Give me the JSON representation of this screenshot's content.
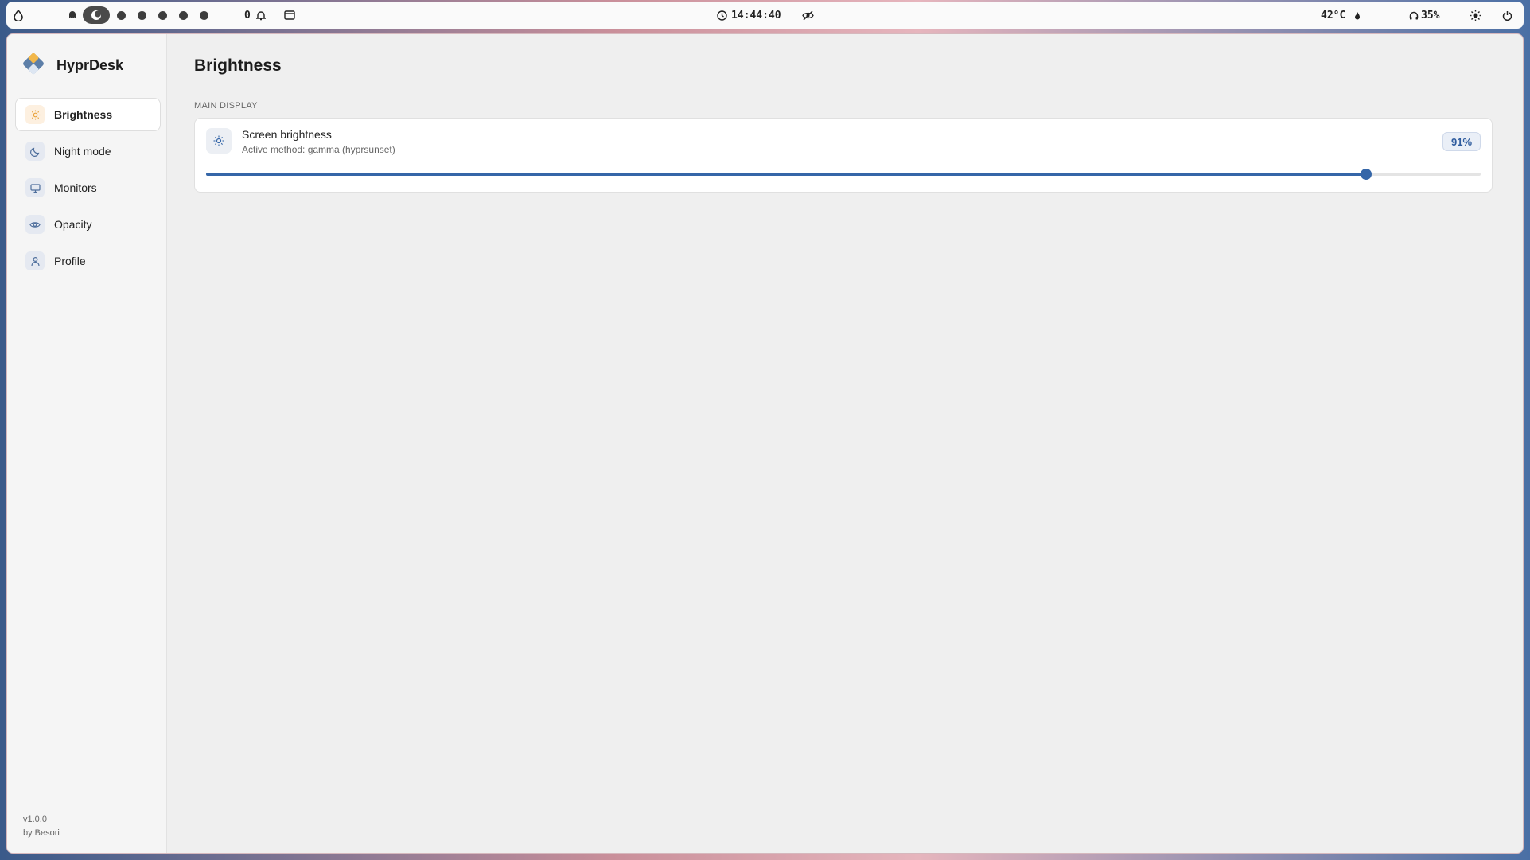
{
  "topbar": {
    "notification_count": "0",
    "clock": "14:44:40",
    "temperature": "42°C",
    "volume": "35%",
    "workspaces_count": 6
  },
  "app": {
    "name": "HyprDesk",
    "version": "v1.0.0",
    "author": "by Besori"
  },
  "sidebar": {
    "items": [
      {
        "label": "Brightness",
        "icon": "sun-icon",
        "active": true
      },
      {
        "label": "Night mode",
        "icon": "moon-icon",
        "active": false
      },
      {
        "label": "Monitors",
        "icon": "monitor-icon",
        "active": false
      },
      {
        "label": "Opacity",
        "icon": "eye-icon",
        "active": false
      },
      {
        "label": "Profile",
        "icon": "user-icon",
        "active": false
      }
    ]
  },
  "main": {
    "title": "Brightness",
    "section_label": "MAIN DISPLAY",
    "card": {
      "title": "Screen brightness",
      "subtitle": "Active method: gamma (hyprsunset)",
      "value_label": "91%",
      "value_fraction": 0.91
    }
  },
  "colors": {
    "accent": "#3566a8",
    "badge_bg": "#eaeff7",
    "active_icon_bg": "#fdf0e0"
  }
}
